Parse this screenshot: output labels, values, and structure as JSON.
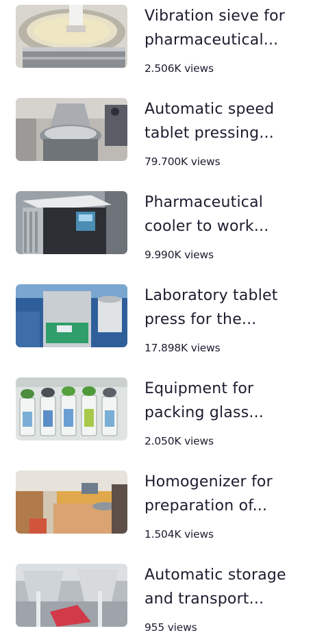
{
  "videos": [
    {
      "title": "Vibration sieve for\npharmaceutical...",
      "views": "2.506K views",
      "thumb_icon": "vibration-sieve-photo"
    },
    {
      "title": "Automatic speed\ntablet pressing...",
      "views": "79.700K views",
      "thumb_icon": "tablet-press-photo"
    },
    {
      "title": "Pharmaceutical\ncooler to work...",
      "views": "9.990K views",
      "thumb_icon": "cooler-photo"
    },
    {
      "title": "Laboratory tablet\npress for the...",
      "views": "17.898K views",
      "thumb_icon": "lab-tablet-press-photo"
    },
    {
      "title": "Equipment for\npacking glass...",
      "views": "2.050K views",
      "thumb_icon": "glass-vials-photo"
    },
    {
      "title": "Homogenizer for\npreparation of...",
      "views": "1.504K views",
      "thumb_icon": "homogenizer-photo"
    },
    {
      "title": "Automatic storage\nand transport...",
      "views": "955 views",
      "thumb_icon": "storage-transport-photo"
    }
  ]
}
